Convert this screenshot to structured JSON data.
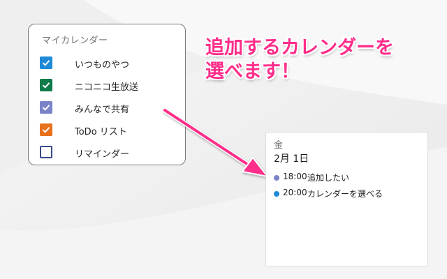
{
  "calendar_list": {
    "title": "マイカレンダー",
    "items": [
      {
        "label": "いつものやつ",
        "checked": true,
        "color": "#1e8ad8"
      },
      {
        "label": "ニコニコ生放送",
        "checked": true,
        "color": "#0f7b4a"
      },
      {
        "label": "みんなで共有",
        "checked": true,
        "color": "#7b83c8"
      },
      {
        "label": "ToDo リスト",
        "checked": true,
        "color": "#e8711c"
      },
      {
        "label": "リマインダー",
        "checked": false,
        "color": "#3b4a8a"
      }
    ]
  },
  "callout": {
    "line1": "追加するカレンダーを",
    "line2": "選べます！",
    "color": "#ff2d8a"
  },
  "day_view": {
    "day_of_week": "金",
    "date": "2月 1日",
    "events": [
      {
        "time": "18:00",
        "title": "追加したい",
        "color": "#7b83c8"
      },
      {
        "time": "20:00",
        "title": "カレンダーを選べる",
        "color": "#1e8ad8"
      }
    ]
  }
}
